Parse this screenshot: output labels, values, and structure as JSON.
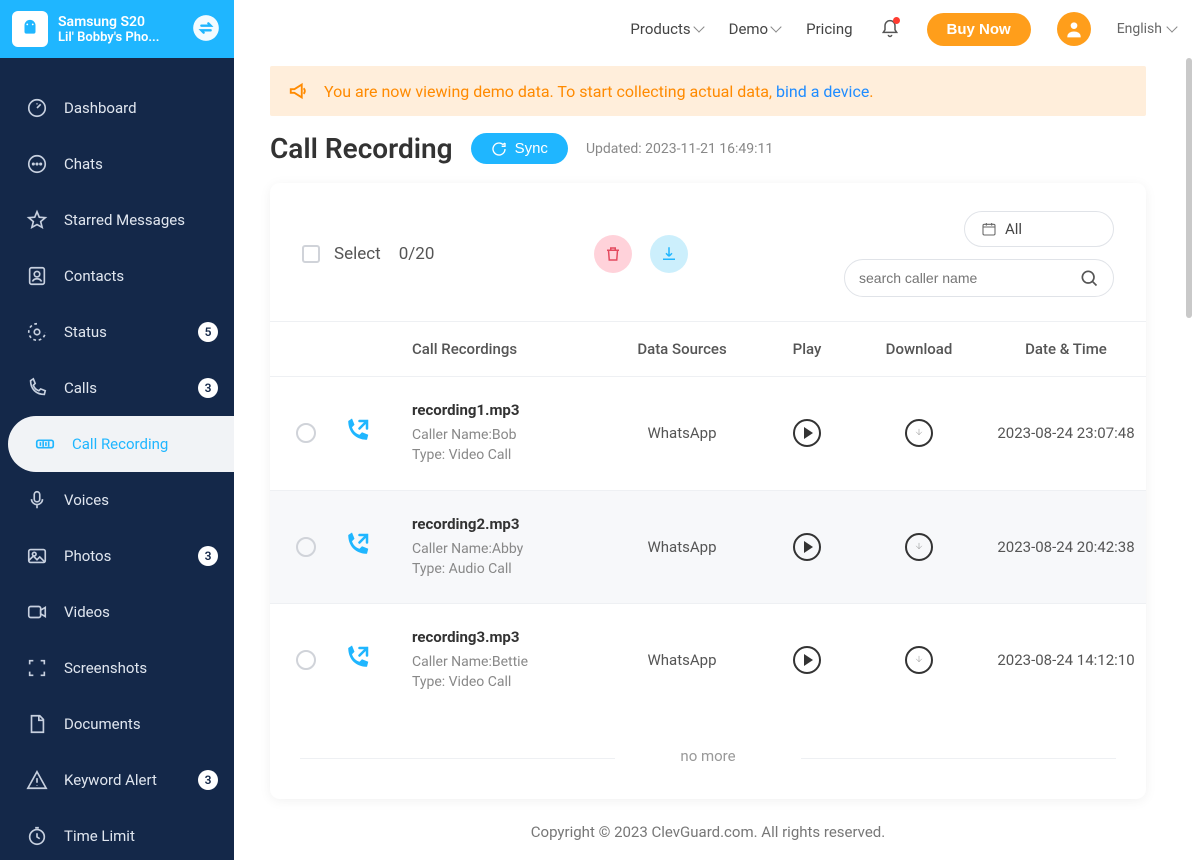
{
  "topnav": {
    "products": "Products",
    "demo": "Demo",
    "pricing": "Pricing",
    "buy_now": "Buy Now",
    "language": "English"
  },
  "device": {
    "name": "Samsung S20",
    "owner": "Lil' Bobby's Pho..."
  },
  "sidebar": [
    {
      "id": "dashboard",
      "label": "Dashboard",
      "badge": null
    },
    {
      "id": "chats",
      "label": "Chats",
      "badge": null
    },
    {
      "id": "starred",
      "label": "Starred Messages",
      "badge": null
    },
    {
      "id": "contacts",
      "label": "Contacts",
      "badge": null
    },
    {
      "id": "status",
      "label": "Status",
      "badge": "5"
    },
    {
      "id": "calls",
      "label": "Calls",
      "badge": "3"
    },
    {
      "id": "call-recording",
      "label": "Call Recording",
      "badge": null,
      "active": true
    },
    {
      "id": "voices",
      "label": "Voices",
      "badge": null
    },
    {
      "id": "photos",
      "label": "Photos",
      "badge": "3"
    },
    {
      "id": "videos",
      "label": "Videos",
      "badge": null
    },
    {
      "id": "screenshots",
      "label": "Screenshots",
      "badge": null
    },
    {
      "id": "documents",
      "label": "Documents",
      "badge": null
    },
    {
      "id": "keyword-alert",
      "label": "Keyword Alert",
      "badge": "3"
    },
    {
      "id": "time-limit",
      "label": "Time Limit",
      "badge": null
    }
  ],
  "banner": {
    "text_pre": "You are now viewing demo data. To start collecting actual data, ",
    "link": "bind a device",
    "text_post": "."
  },
  "page": {
    "title": "Call Recording",
    "sync": "Sync",
    "updated": "Updated: 2023-11-21 16:49:11"
  },
  "toolbar": {
    "select_label": "Select",
    "select_count": "0/20",
    "date_filter": "All",
    "search_placeholder": "search caller name"
  },
  "table": {
    "headers": {
      "recordings": "Call Recordings",
      "sources": "Data Sources",
      "play": "Play",
      "download": "Download",
      "datetime": "Date & Time"
    },
    "rows": [
      {
        "file": "recording1.mp3",
        "caller_label": "Caller Name:",
        "caller": "Bob",
        "type_label": "Type:",
        "type": "Video Call",
        "source": "WhatsApp",
        "datetime": "2023-08-24 23:07:48"
      },
      {
        "file": "recording2.mp3",
        "caller_label": "Caller Name:",
        "caller": "Abby",
        "type_label": "Type:",
        "type": "Audio Call",
        "source": "WhatsApp",
        "datetime": "2023-08-24 20:42:38"
      },
      {
        "file": "recording3.mp3",
        "caller_label": "Caller Name:",
        "caller": "Bettie",
        "type_label": "Type:",
        "type": "Video Call",
        "source": "WhatsApp",
        "datetime": "2023-08-24 14:12:10"
      }
    ],
    "no_more": "no more"
  },
  "footer": "Copyright © 2023 ClevGuard.com. All rights reserved."
}
